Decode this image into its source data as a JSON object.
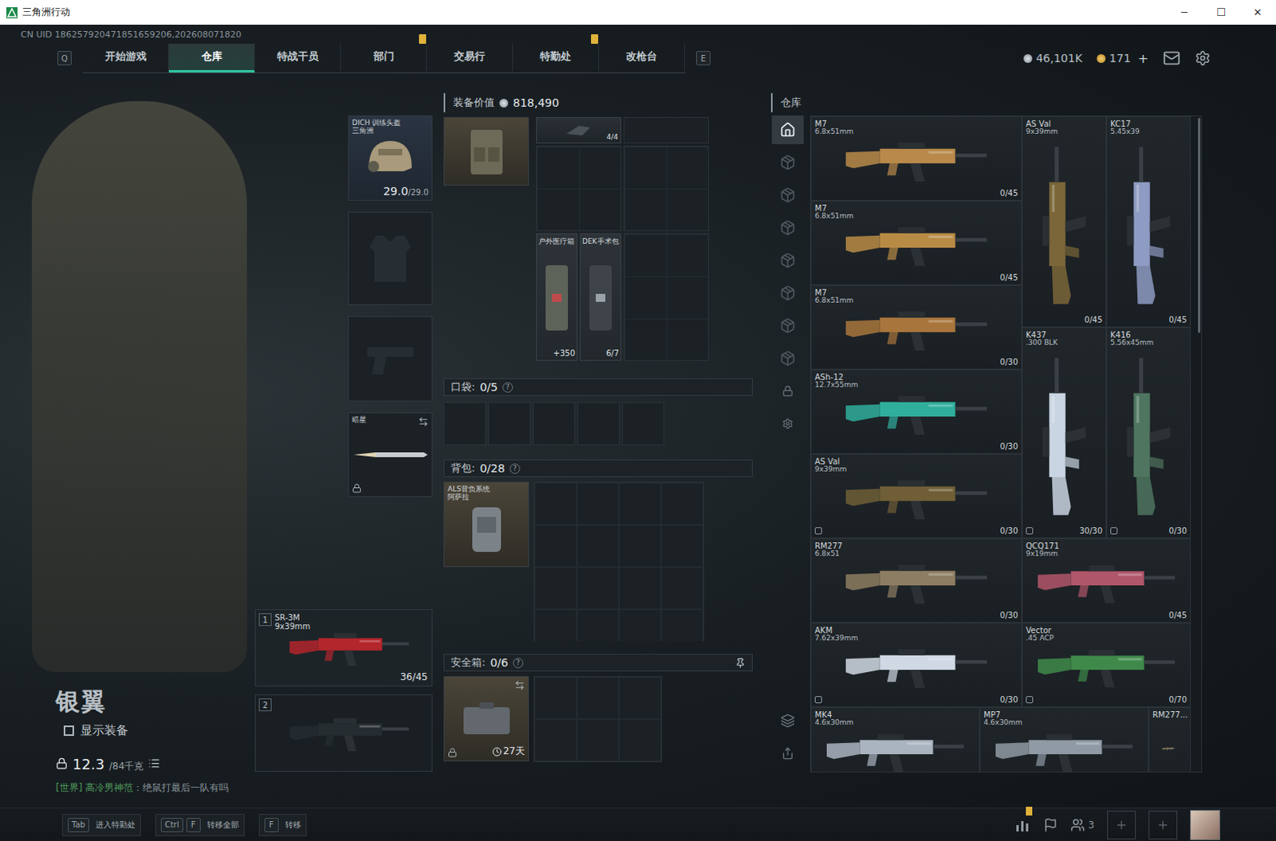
{
  "window": {
    "title": "三角洲行动",
    "controls": [
      "─",
      "☐",
      "✕"
    ]
  },
  "uid": "CN UID 186257920471851659206,202608071820",
  "nav": {
    "keys": [
      "Q",
      "E"
    ],
    "tabs": [
      {
        "label": "开始游戏",
        "selected": false,
        "alert": false
      },
      {
        "label": "仓库",
        "selected": true,
        "alert": false
      },
      {
        "label": "特战干员",
        "selected": false,
        "alert": false
      },
      {
        "label": "部门",
        "selected": false,
        "alert": true
      },
      {
        "label": "交易行",
        "selected": false,
        "alert": false
      },
      {
        "label": "特勤处",
        "selected": false,
        "alert": true
      },
      {
        "label": "改枪台",
        "selected": false,
        "alert": false
      }
    ],
    "coins": {
      "value": "46,101K"
    },
    "tokens": {
      "value": "171",
      "add": "+"
    }
  },
  "character": {
    "name": "银翼",
    "show_gear": {
      "label": "显示装备",
      "checked": false
    },
    "weight": "12.3",
    "weight_max": "/84千克"
  },
  "chat": {
    "channel": "[世界] 高冷男神范",
    "message": "：绝鼠打最后一队有吗"
  },
  "equipment": {
    "helmet": {
      "name": "DICH 训练头盔",
      "sub": "三角洲",
      "durability": "29.0",
      "max": "/29.0"
    },
    "melee": {
      "name": "暗星",
      "locked": true
    },
    "weapons": [
      {
        "slot": "1",
        "name": "SR-3M",
        "caliber": "9x39mm",
        "ammo": "36/45",
        "empty": false
      },
      {
        "slot": "2",
        "empty": true
      }
    ]
  },
  "loadout": {
    "value_label": "装备价值",
    "value": "818,490",
    "rig": {
      "top_item": {
        "count": "4/4"
      },
      "med_kits": [
        {
          "name": "户外医疗箱",
          "count": "+350"
        },
        {
          "name": "DEK手术包",
          "count": "6/7"
        }
      ]
    },
    "pocket": {
      "label": "口袋:",
      "count": "0/5",
      "help": "?"
    },
    "backpack": {
      "label": "背包:",
      "count": "0/28",
      "help": "?",
      "name": "ALS背负系统",
      "sub": "阿萨拉"
    },
    "secure": {
      "label": "安全箱:",
      "count": "0/6",
      "help": "?",
      "days": "27天",
      "locked": true
    }
  },
  "warehouse": {
    "title": "仓库",
    "side_tabs": [
      {
        "selected": true
      },
      {
        "selected": false
      },
      {
        "selected": false
      },
      {
        "selected": false
      },
      {
        "selected": false
      },
      {
        "selected": false
      },
      {
        "selected": false
      },
      {
        "selected": false
      }
    ],
    "items": [
      {
        "name": "M7",
        "caliber": "6.8x51mm",
        "ammo": "0/45",
        "kind": "long",
        "color": "#b8894a",
        "marked": false
      },
      {
        "name": "AS Val",
        "caliber": "9x39mm",
        "ammo": "0/45",
        "kind": "tall",
        "color": "#7a6638",
        "marked": false
      },
      {
        "name": "KC17",
        "caliber": "5.45x39",
        "ammo": "0/45",
        "kind": "tall",
        "color": "#8e9bc2",
        "marked": false
      },
      {
        "name": "M7",
        "caliber": "6.8x51mm",
        "ammo": "0/45",
        "kind": "long",
        "color": "#b88b45",
        "marked": false
      },
      {
        "name": "M7",
        "caliber": "6.8x51mm",
        "ammo": "0/30",
        "kind": "long",
        "color": "#a8753c",
        "marked": false
      },
      {
        "name": "K437",
        "caliber": ".300 BLK",
        "ammo": "30/30",
        "kind": "tall",
        "color": "#c9d5e2",
        "marked": true
      },
      {
        "name": "K416",
        "caliber": "5.56x45mm",
        "ammo": "0/30",
        "kind": "tall",
        "color": "#4f7560",
        "marked": true
      },
      {
        "name": "ASh-12",
        "caliber": "12.7x55mm",
        "ammo": "0/30",
        "kind": "long",
        "color": "#2fae9c",
        "marked": false
      },
      {
        "name": "AS Val",
        "caliber": "9x39mm",
        "ammo": "0/30",
        "kind": "long",
        "color": "#6f5e36",
        "marked": true
      },
      {
        "name": "RM277",
        "caliber": "6.8x51",
        "ammo": "0/30",
        "kind": "long",
        "color": "#8d7d62",
        "marked": false
      },
      {
        "name": "QCQ171",
        "caliber": "9x19mm",
        "ammo": "0/45",
        "kind": "mid",
        "color": "#b0566a",
        "marked": false
      },
      {
        "name": "AKM",
        "caliber": "7.62x39mm",
        "ammo": "0/30",
        "kind": "long",
        "color": "#d0d8e4",
        "marked": true
      },
      {
        "name": "Vector",
        "caliber": ".45 ACP",
        "ammo": "0/70",
        "kind": "mid",
        "color": "#3f8a4a",
        "marked": true
      },
      {
        "name": "MK4",
        "caliber": "4.6x30mm",
        "kind": "mid",
        "color": "#aab4c0",
        "marked": false
      },
      {
        "name": "MP7",
        "caliber": "4.6x30mm",
        "kind": "mid",
        "color": "#8f9aa5",
        "marked": false
      },
      {
        "name": "RM277...",
        "kind": "stub",
        "color": "#8d7d62",
        "marked": false
      }
    ]
  },
  "bottom": {
    "hints": [
      {
        "keys": [
          "Tab"
        ],
        "label": "进入特勤处"
      },
      {
        "keys": [
          "Ctrl",
          "F"
        ],
        "label": "转移全部"
      },
      {
        "keys": [
          "F"
        ],
        "label": "转移"
      }
    ],
    "friends": "3",
    "stats_alert": true
  }
}
